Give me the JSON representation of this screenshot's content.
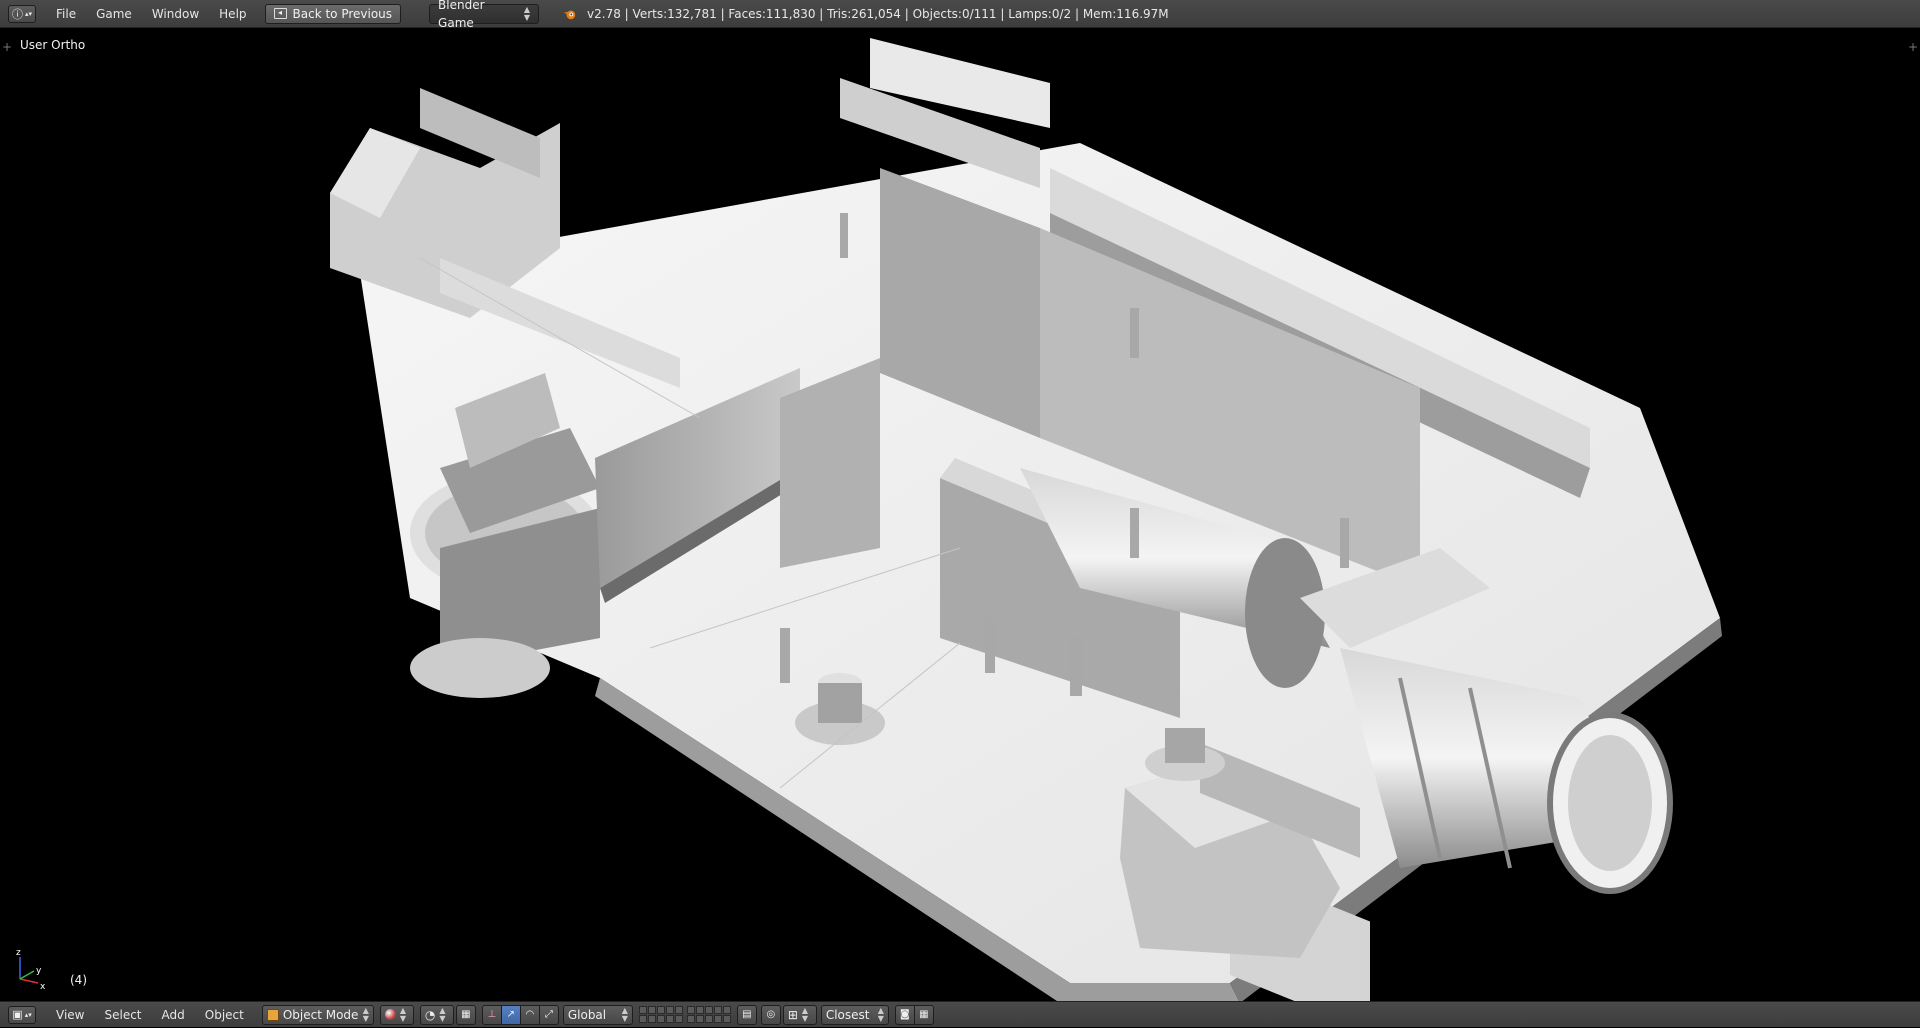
{
  "info_header": {
    "editor_type_icon": "info-icon",
    "menus": [
      "File",
      "Game",
      "Window",
      "Help"
    ],
    "back_button": "Back to Previous",
    "engine": "Blender Game",
    "stats": "v2.78 | Verts:132,781 | Faces:111,830 | Tris:261,054 | Objects:0/111 | Lamps:0/2 | Mem:116.97M"
  },
  "viewport": {
    "view_label": "User Ortho",
    "frame": "(4)",
    "axis_labels": {
      "x": "x",
      "y": "y",
      "z": "z"
    }
  },
  "view3d_header": {
    "editor_type_icon": "3d-view-icon",
    "menus": [
      "View",
      "Select",
      "Add",
      "Object"
    ],
    "mode": "Object Mode",
    "orientation": "Global",
    "snap_target": "Closest"
  },
  "colors": {
    "header_bg": "#454545",
    "viewport_bg": "#000000",
    "active_blue": "#4a74b8",
    "model_light": "#f2f2f2",
    "model_mid": "#bdbdbd",
    "model_dark": "#7a7a7a"
  }
}
